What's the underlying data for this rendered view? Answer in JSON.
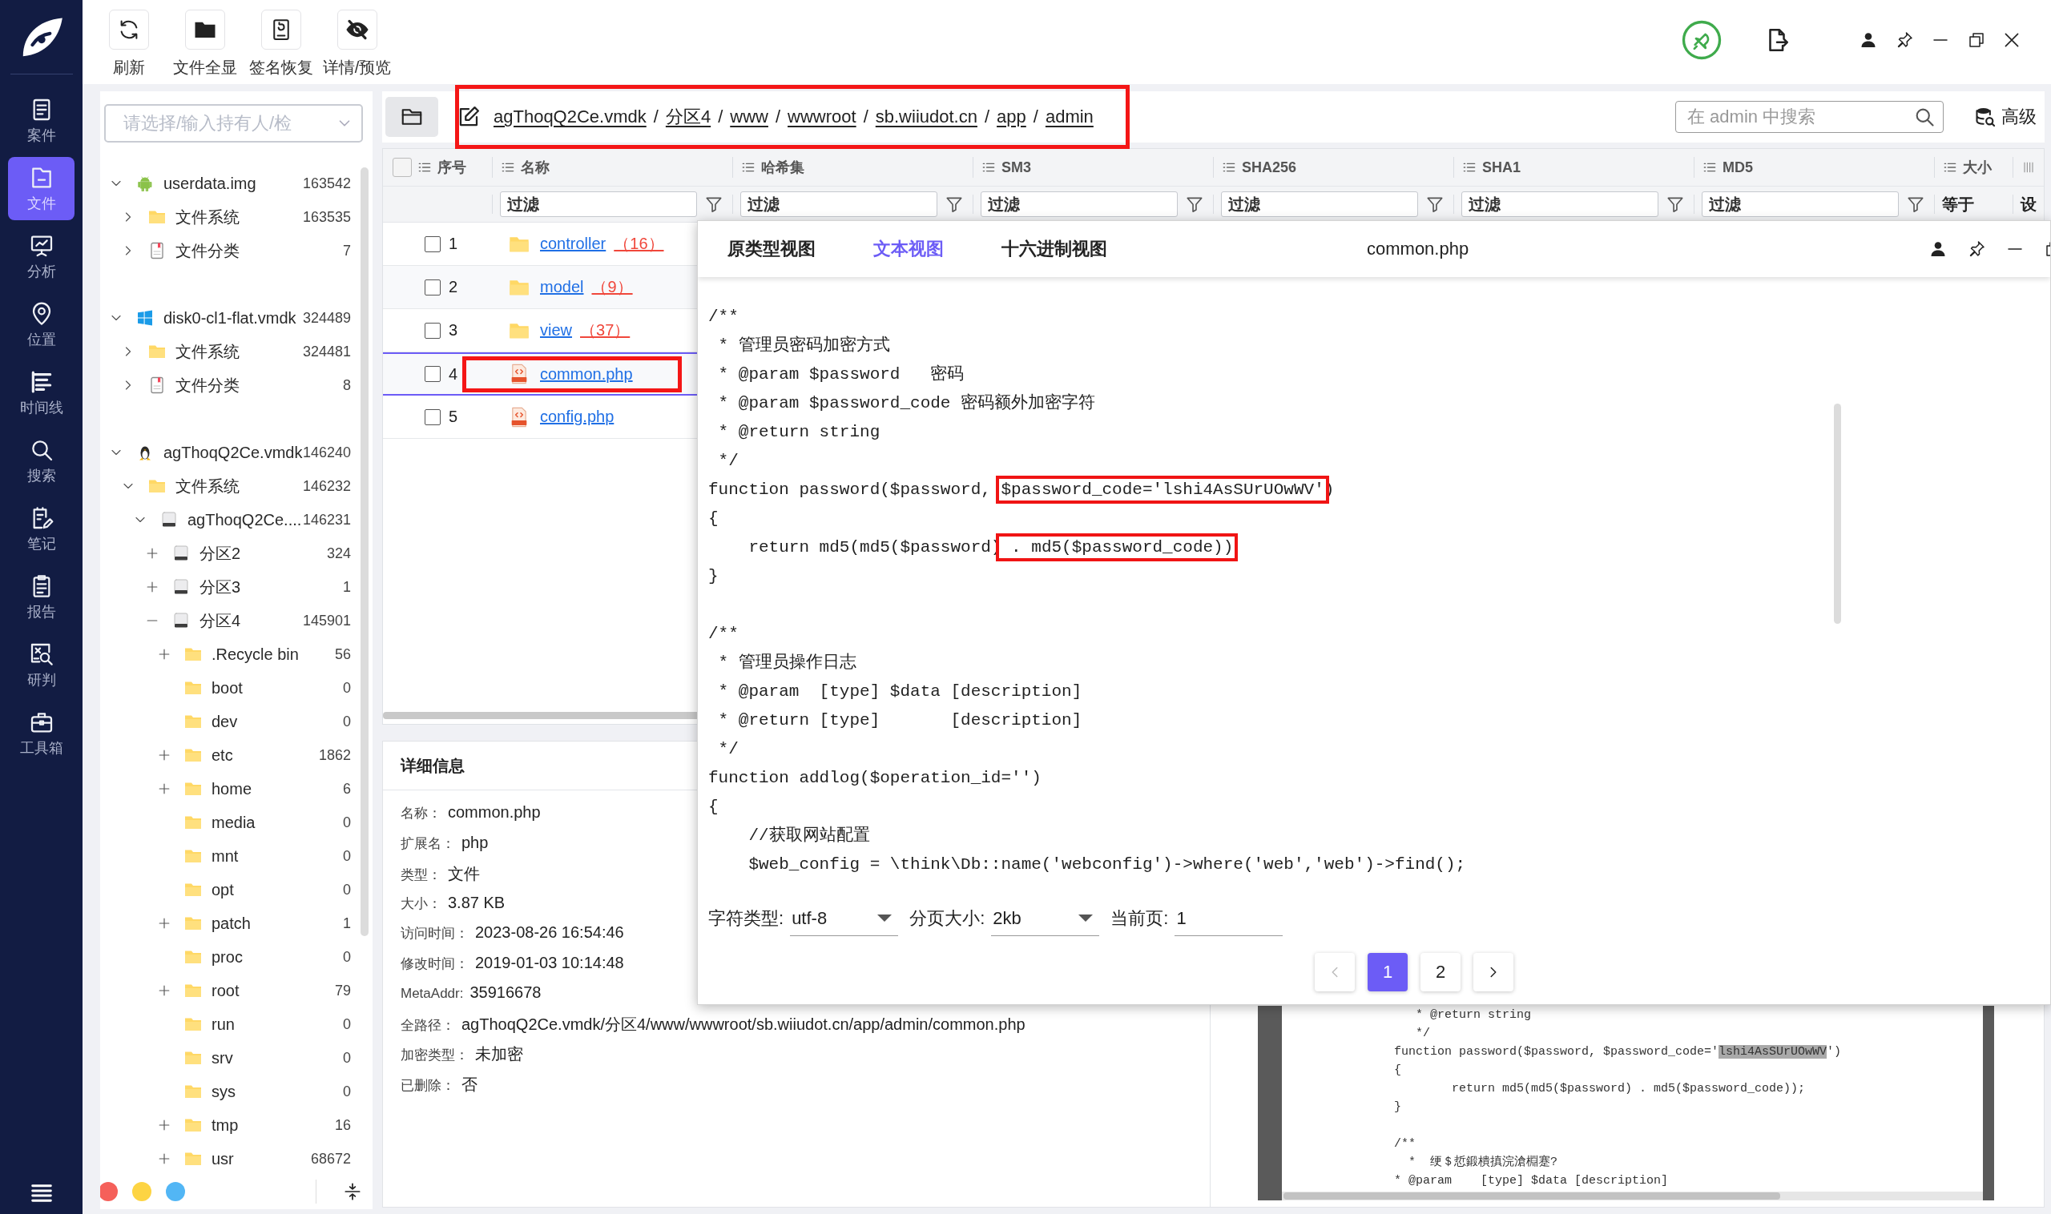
{
  "nav": {
    "items": [
      {
        "label": "案件",
        "selected": false
      },
      {
        "label": "文件",
        "selected": true
      },
      {
        "label": "分析",
        "selected": false
      },
      {
        "label": "位置",
        "selected": false
      },
      {
        "label": "时间线",
        "selected": false
      },
      {
        "label": "搜索",
        "selected": false
      },
      {
        "label": "笔记",
        "selected": false
      },
      {
        "label": "报告",
        "selected": false
      },
      {
        "label": "研判",
        "selected": false
      },
      {
        "label": "工具箱",
        "selected": false
      }
    ]
  },
  "toolbar": {
    "buttons": [
      {
        "label": "刷新"
      },
      {
        "label": "文件全显"
      },
      {
        "label": "签名恢复"
      },
      {
        "label": "详情/预览"
      }
    ]
  },
  "evidence_select": {
    "placeholder": "请选择/输入持有人/检"
  },
  "tree": [
    {
      "label": "userdata.img",
      "count": "163542",
      "kind": "android",
      "expanded": true,
      "children": [
        {
          "label": "文件系统",
          "count": "163535",
          "kind": "folder",
          "expanded": false
        },
        {
          "label": "文件分类",
          "count": "7",
          "kind": "category",
          "expanded": false
        }
      ]
    },
    {
      "label": "disk0-cl1-flat.vmdk",
      "count": "324489",
      "kind": "windows",
      "expanded": true,
      "children": [
        {
          "label": "文件系统",
          "count": "324481",
          "kind": "folder",
          "expanded": false
        },
        {
          "label": "文件分类",
          "count": "8",
          "kind": "category",
          "expanded": false
        }
      ]
    },
    {
      "label": "agThoqQ2Ce.vmdk",
      "count": "146240",
      "kind": "linux",
      "expanded": true,
      "children": [
        {
          "label": "文件系统",
          "count": "146232",
          "kind": "folder",
          "expanded": true,
          "children": [
            {
              "label": "agThoqQ2Ce....",
              "count": "146231",
              "kind": "disk",
              "expanded": true,
              "children": [
                {
                  "label": "分区2",
                  "count": "324",
                  "kind": "disk",
                  "expanded": false
                },
                {
                  "label": "分区3",
                  "count": "1",
                  "kind": "disk",
                  "expanded": false
                },
                {
                  "label": "分区4",
                  "count": "145901",
                  "kind": "disk",
                  "expanded": true,
                  "children": [
                    {
                      "label": ".Recycle bin",
                      "count": "56",
                      "kind": "folder",
                      "expanded": false
                    },
                    {
                      "label": "boot",
                      "count": "0",
                      "kind": "folder"
                    },
                    {
                      "label": "dev",
                      "count": "0",
                      "kind": "folder"
                    },
                    {
                      "label": "etc",
                      "count": "1862",
                      "kind": "folder",
                      "expanded": false
                    },
                    {
                      "label": "home",
                      "count": "6",
                      "kind": "folder",
                      "expanded": false
                    },
                    {
                      "label": "media",
                      "count": "0",
                      "kind": "folder"
                    },
                    {
                      "label": "mnt",
                      "count": "0",
                      "kind": "folder"
                    },
                    {
                      "label": "opt",
                      "count": "0",
                      "kind": "folder"
                    },
                    {
                      "label": "patch",
                      "count": "1",
                      "kind": "folder",
                      "expanded": false
                    },
                    {
                      "label": "proc",
                      "count": "0",
                      "kind": "folder"
                    },
                    {
                      "label": "root",
                      "count": "79",
                      "kind": "folder",
                      "expanded": false
                    },
                    {
                      "label": "run",
                      "count": "0",
                      "kind": "folder"
                    },
                    {
                      "label": "srv",
                      "count": "0",
                      "kind": "folder"
                    },
                    {
                      "label": "sys",
                      "count": "0",
                      "kind": "folder"
                    },
                    {
                      "label": "tmp",
                      "count": "16",
                      "kind": "folder",
                      "expanded": false
                    },
                    {
                      "label": "usr",
                      "count": "68672",
                      "kind": "folder",
                      "expanded": false
                    }
                  ]
                }
              ]
            }
          ]
        }
      ]
    }
  ],
  "color_tags": [
    {
      "color": "#f5605a"
    },
    {
      "color": "#fdd443"
    },
    {
      "color": "#52b6f5"
    }
  ],
  "path_bar": {
    "boxed": true,
    "crumbs": [
      {
        "kind": "link",
        "text": "agThoqQ2Ce.vmdk"
      },
      {
        "kind": "separator",
        "text": "/"
      },
      {
        "kind": "link",
        "text": "分区4"
      },
      {
        "kind": "separator",
        "text": "/"
      },
      {
        "kind": "link",
        "text": "www"
      },
      {
        "kind": "separator",
        "text": "/"
      },
      {
        "kind": "link",
        "text": "wwwroot"
      },
      {
        "kind": "separator",
        "text": "/"
      },
      {
        "kind": "link",
        "text": "sb.wiiudot.cn"
      },
      {
        "kind": "separator",
        "text": "/"
      },
      {
        "kind": "link",
        "text": "app"
      },
      {
        "kind": "separator",
        "text": "/"
      },
      {
        "kind": "link",
        "text": "admin"
      }
    ]
  },
  "search": {
    "placeholder": "在 admin 中搜索"
  },
  "advanced_button": {
    "label": "高级"
  },
  "table": {
    "all_checked": false,
    "columns": [
      "序号",
      "名称",
      "哈希集",
      "SM3",
      "SHA256",
      "SHA1",
      "MD5",
      "大小"
    ],
    "filters": [
      {
        "kind": "input",
        "placeholder": "过滤"
      },
      {
        "kind": "input",
        "placeholder": "过滤"
      },
      {
        "kind": "input",
        "placeholder": "过滤"
      },
      {
        "kind": "input",
        "placeholder": "过滤"
      },
      {
        "kind": "input",
        "placeholder": "过滤"
      },
      {
        "kind": "input",
        "placeholder": "过滤"
      },
      {
        "kind": "text",
        "text": "等于"
      }
    ],
    "settings_label": "设",
    "rows": [
      {
        "number": "1",
        "name": "controller",
        "count": "（16）",
        "kind": "folder",
        "checked": false,
        "selected": false,
        "boxed": false
      },
      {
        "number": "2",
        "name": "model",
        "count": "（9）",
        "kind": "folder",
        "checked": false,
        "selected": false,
        "boxed": false
      },
      {
        "number": "3",
        "name": "view",
        "count": "（37）",
        "kind": "folder",
        "checked": false,
        "selected": false,
        "boxed": false
      },
      {
        "number": "4",
        "name": "common.php",
        "kind": "html",
        "checked": false,
        "selected": true,
        "boxed": true
      },
      {
        "number": "5",
        "name": "config.php",
        "kind": "html",
        "checked": false,
        "selected": false,
        "boxed": false
      }
    ]
  },
  "details": {
    "title": "详细信息",
    "fields": [
      {
        "label": "名称：",
        "value": "common.php"
      },
      {
        "label": "扩展名：",
        "value": "php"
      },
      {
        "label": "类型：",
        "value": "文件"
      },
      {
        "label": "大小：",
        "value": "3.87 KB"
      },
      {
        "label": "访问时间：",
        "value": "2023-08-26 16:54:46"
      },
      {
        "label": "修改时间：",
        "value": "2019-01-03 10:14:48"
      },
      {
        "label": "MetaAddr:",
        "value": "35916678"
      },
      {
        "label": "全路径：",
        "value": "agThoqQ2Ce.vmdk/分区4/www/wwwroot/sb.wiiudot.cn/app/admin/common.php"
      },
      {
        "label": "加密类型：",
        "value": "未加密"
      },
      {
        "label": "已删除：",
        "value": "否"
      }
    ]
  },
  "preview": {
    "lines": [
      {
        "kind": "plain",
        "text": "   * @return string"
      },
      {
        "kind": "plain",
        "text": "   */"
      },
      {
        "kind": "segmented",
        "segments": [
          {
            "text": "function password($password, $password_code='",
            "marked": false
          },
          {
            "text": "lshi4AsSUrUOwWV",
            "marked": true
          },
          {
            "text": "')",
            "marked": false
          }
        ]
      },
      {
        "kind": "plain",
        "text": "{"
      },
      {
        "kind": "plain",
        "text": "        return md5(md5($password) . md5($password_code));"
      },
      {
        "kind": "plain",
        "text": "}"
      },
      {
        "kind": "blank"
      },
      {
        "kind": "plain",
        "text": "/**"
      },
      {
        "kind": "plain",
        "text": "  *  绠＄悊鍛樻搷浣滄棩蹇?"
      },
      {
        "kind": "plain",
        "text": "* @param    [type] $data [description]"
      }
    ]
  },
  "viewer": {
    "tabs": [
      {
        "label": "原类型视图",
        "selected": false
      },
      {
        "label": "文本视图",
        "selected": true
      },
      {
        "label": "十六进制视图",
        "selected": false
      }
    ],
    "title": "common.php",
    "code": [
      {
        "kind": "plain",
        "text": "/**"
      },
      {
        "kind": "plain",
        "text": " * 管理员密码加密方式"
      },
      {
        "kind": "plain",
        "text": " * @param $password   密码"
      },
      {
        "kind": "plain",
        "text": " * @param $password_code 密码额外加密字符"
      },
      {
        "kind": "plain",
        "text": " * @return string"
      },
      {
        "kind": "plain",
        "text": " */"
      },
      {
        "kind": "segmented",
        "segments": [
          {
            "text": "function password($password, ",
            "boxed": false
          },
          {
            "text": "$password_code='lshi4AsSUrUOwWV'",
            "boxed": true
          },
          {
            "text": ")",
            "boxed": false
          }
        ]
      },
      {
        "kind": "plain",
        "text": "{"
      },
      {
        "kind": "segmented",
        "segments": [
          {
            "text": "    return md5(md5($password)",
            "boxed": false
          },
          {
            "text": " . md5($password_code))",
            "boxed": true
          }
        ]
      },
      {
        "kind": "plain",
        "text": "}"
      },
      {
        "kind": "blank"
      },
      {
        "kind": "plain",
        "text": "/**"
      },
      {
        "kind": "plain",
        "text": " * 管理员操作日志"
      },
      {
        "kind": "plain",
        "text": " * @param  [type] $data [description]"
      },
      {
        "kind": "plain",
        "text": " * @return [type]       [description]"
      },
      {
        "kind": "plain",
        "text": " */"
      },
      {
        "kind": "plain",
        "text": "function addlog($operation_id='')"
      },
      {
        "kind": "plain",
        "text": "{"
      },
      {
        "kind": "plain",
        "text": "    //获取网站配置"
      },
      {
        "kind": "plain",
        "text": "    $web_config = \\think\\Db::name('webconfig')->where('web','web')->find();"
      }
    ],
    "charset": {
      "label": "字符类型:",
      "value": "utf-8"
    },
    "page_size": {
      "label": "分页大小:",
      "value": "2kb"
    },
    "current_page": {
      "label": "当前页:",
      "value": "1"
    },
    "pages": [
      {
        "label": "1",
        "selected": true
      },
      {
        "label": "2",
        "selected": false
      }
    ]
  }
}
